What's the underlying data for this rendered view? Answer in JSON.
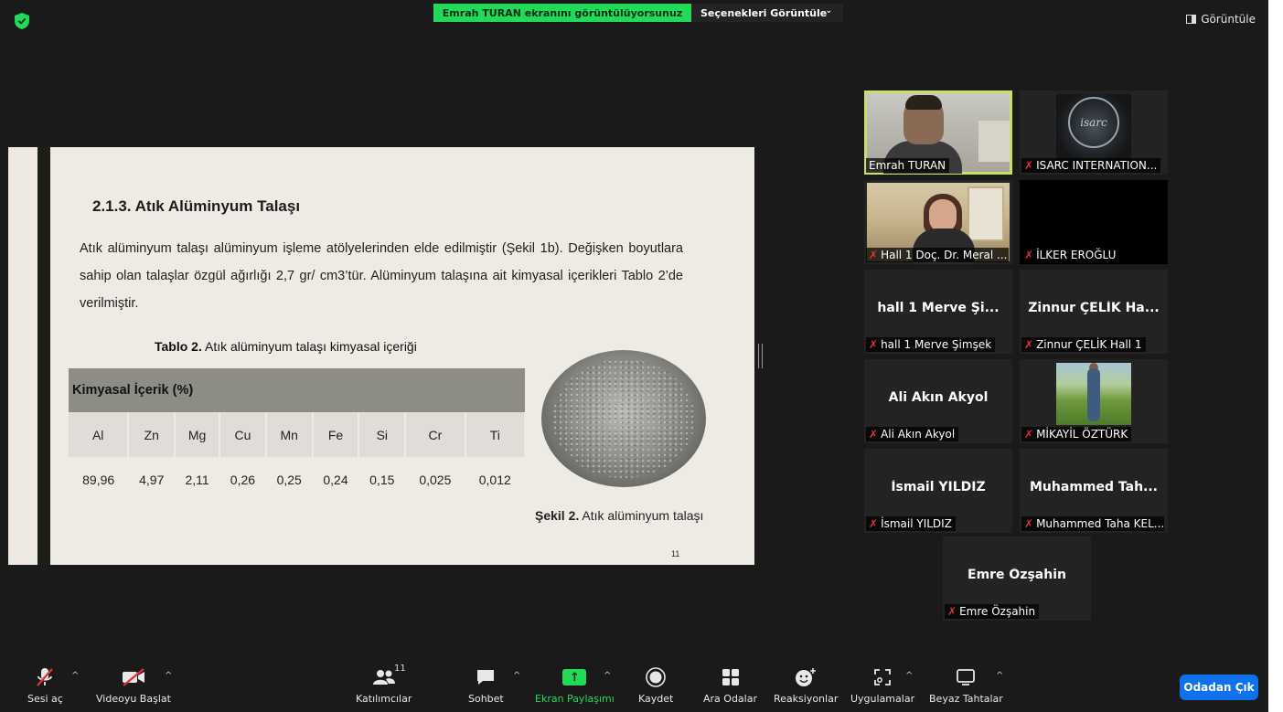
{
  "topbar": {
    "share_banner": "Emrah TURAN ekranını görüntülüyorsunuz",
    "share_options": "Seçenekleri Görüntüle",
    "share_options_chevron": "⌄",
    "view_label": "Görüntüle",
    "accent_green": "#23d959"
  },
  "slide": {
    "title": "2.1.3. Atık Alüminyum Talaşı",
    "paragraph": "Atık alüminyum talaşı alüminyum işleme atölyelerinden elde edilmiştir (Şekil 1b). Değişken boyutlara sahip olan talaşlar özgül ağırlığı 2,7 gr/ cm3’tür. Alüminyum talaşına ait kimyasal içerikleri Tablo 2’de verilmiştir.",
    "table_caption_bold": "Tablo 2.",
    "table_caption_rest": " Atık alüminyum talaşı kimyasal içeriği",
    "table_header": "Kimyasal İçerik (%)",
    "elements": [
      "Al",
      "Zn",
      "Mg",
      "Cu",
      "Mn",
      "Fe",
      "Si",
      "Cr",
      "Ti"
    ],
    "values": [
      "89,96",
      "4,97",
      "2,11",
      "0,26",
      "0,25",
      "0,24",
      "0,15",
      "0,025",
      "0,012"
    ],
    "figure_caption_bold": "Şekil 2.",
    "figure_caption_rest": " Atık alüminyum talaşı",
    "page_number": "11"
  },
  "participants": [
    {
      "display": "",
      "label": "Emrah TURAN",
      "muted": false,
      "video": "camera",
      "active": true
    },
    {
      "display": "",
      "label": "ISARC INTERNATION...",
      "muted": true,
      "video": "logo",
      "logo_text": "isarc"
    },
    {
      "display": "",
      "label": "Hall 1 Doç. Dr. Meral ...",
      "muted": true,
      "video": "camera"
    },
    {
      "display": "",
      "label": "İLKER EROĞLU",
      "muted": true,
      "video": "black"
    },
    {
      "display": "hall 1 Merve Şi...",
      "label": "hall 1 Merve Şimşek",
      "muted": true,
      "video": "off"
    },
    {
      "display": "Zinnur ÇELİK Ha...",
      "label": "Zinnur ÇELİK Hall 1",
      "muted": true,
      "video": "off"
    },
    {
      "display": "Ali Akın Akyol",
      "label": "Ali Akın Akyol",
      "muted": true,
      "video": "off"
    },
    {
      "display": "",
      "label": "MİKAYİL ÖZTÜRK",
      "muted": true,
      "video": "photo"
    },
    {
      "display": "İsmail YILDIZ",
      "label": "İsmail YILDIZ",
      "muted": true,
      "video": "off"
    },
    {
      "display": "Muhammed Tah...",
      "label": "Muhammed Taha KEL...",
      "muted": true,
      "video": "off"
    },
    {
      "display": "Emre Özşahin",
      "label": "Emre Özşahin",
      "muted": true,
      "video": "off"
    }
  ],
  "toolbar": {
    "mute": "Sesi aç",
    "video": "Videoyu Başlat",
    "participants": "Katılımcılar",
    "participants_count": "11",
    "chat": "Sohbet",
    "share": "Ekran Paylaşımı",
    "record": "Kaydet",
    "breakout": "Ara Odalar",
    "reactions": "Reaksiyonlar",
    "apps": "Uygulamalar",
    "whiteboard": "Beyaz Tahtalar",
    "leave": "Odadan Çık",
    "caret": "^",
    "leave_color": "#0e71eb",
    "muted_color": "#e0303b"
  }
}
